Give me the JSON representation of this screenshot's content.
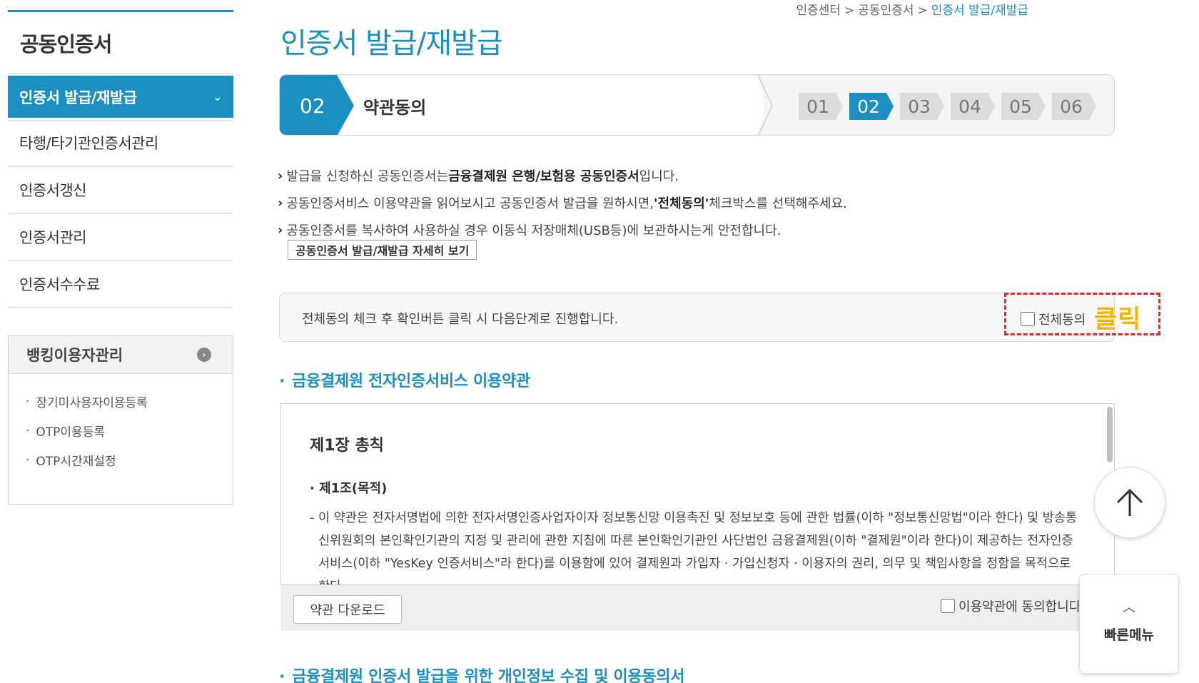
{
  "breadcrumb": [
    "인증센터",
    "공동인증서",
    "인증서 발급/재발급"
  ],
  "sidebar": {
    "title": "공동인증서",
    "items": [
      {
        "label": "인증서 발급/재발급",
        "active": true
      },
      {
        "label": "타행/타기관인증서관리"
      },
      {
        "label": "인증서갱신"
      },
      {
        "label": "인증서관리"
      },
      {
        "label": "인증서수수료"
      }
    ],
    "bank": {
      "title": "뱅킹이용자관리",
      "items": [
        "장기미사용자이용등록",
        "OTP이용등록",
        "OTP시간재설정"
      ]
    }
  },
  "main": {
    "title": "인증서 발급/재발급",
    "step": {
      "current_num": "02",
      "current_label": "약관동의",
      "nums": [
        "01",
        "02",
        "03",
        "04",
        "05",
        "06"
      ],
      "active_index": 1
    },
    "notes": {
      "n1_pre": "발급을 신청하신 공동인증서는 ",
      "n1_bold": "금융결제원 은행/보험용 공동인증서",
      "n1_post": " 입니다.",
      "n2_pre": "공동인증서비스 이용약관을 읽어보시고 공동인증서 발급을 원하시면, ",
      "n2_bold": "'전체동의'",
      "n2_post": " 체크박스를 선택해주세요.",
      "n3": "공동인증서를 복사하여 사용하실 경우 이동식 저장매체(USB등)에 보관하시는게 안전합니다."
    },
    "detail_button": "공동인증서 발급/재발급 자세히 보기",
    "agree_all": {
      "text": "전체동의 체크 후 확인버튼 클릭 시 다음단계로 진행합니다.",
      "checkbox_label": "전체동의",
      "annotation": "클릭"
    },
    "terms": {
      "section_title": "금융결제원 전자인증서비스 이용약관",
      "chapter": "제1장 총칙",
      "article": "제1조(목적)",
      "body": "이 약관은 전자서명법에 의한 전자서명인증사업자이자 정보통신망 이용촉진 및 정보보호 등에 관한 법률(이하 \"정보통신망법\"이라 한다) 및 방송통신위원회의 본인확인기관의 지정 및 관리에 관한 지침에 따른 본인확인기관인 사단법인 금융결제원(이하 \"결제원\"이라 한다)이 제공하는 전자인증서비스(이하 \"YesKey 인증서비스\"라 한다)를 이용함에 있어 결제원과 가입자 · 가입신청자 · 이용자의 권리, 의무 및 책임사항을 정함을 목적으로 한다.",
      "download_button": "약관 다운로드",
      "agree_label": "이용약관에 동의합니다"
    },
    "privacy_section_title": "금융결제원 인증서 발급을 위한 개인정보 수집 및 이용동의서"
  },
  "quick_menu": {
    "label": "빠른메뉴"
  },
  "colors": {
    "accent": "#1a8fc0",
    "highlight": "#f5b400",
    "dashed_border": "#e8232a"
  },
  "icons": {
    "top": "arrow-up-icon",
    "quick": "chevron-up-icon",
    "sidebar_active": "chevron-down-icon",
    "bank": "arrow-right-circle-icon"
  }
}
